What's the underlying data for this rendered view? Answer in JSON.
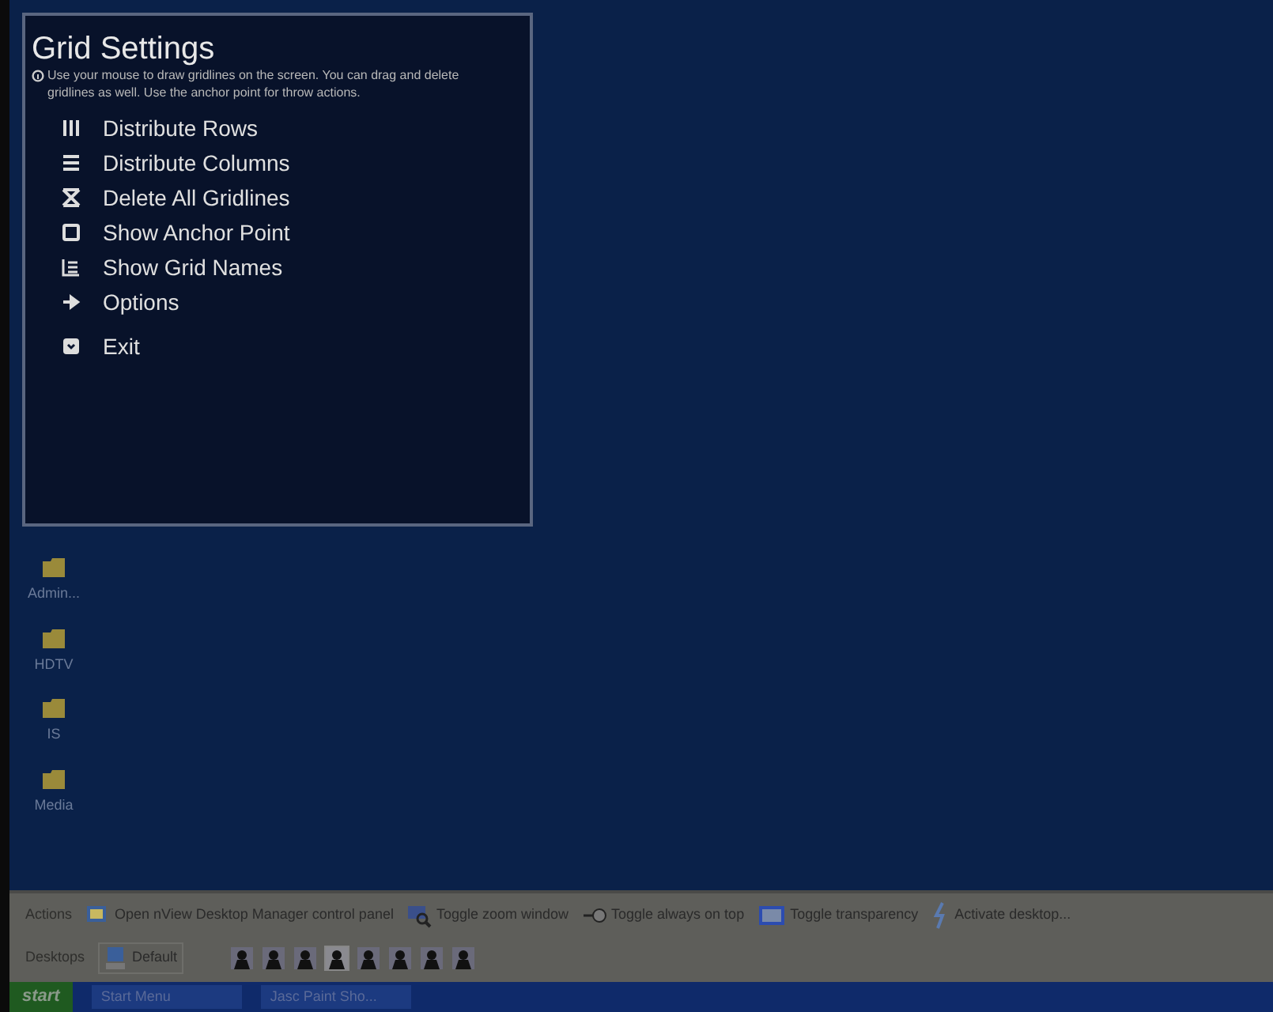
{
  "panel": {
    "title": "Grid Settings",
    "description": "Use your mouse to draw gridlines on the screen. You can drag and delete gridlines as well. Use the anchor point for throw actions.",
    "items": [
      {
        "kind": "rows",
        "label": "Distribute Rows"
      },
      {
        "kind": "columns",
        "label": "Distribute Columns"
      },
      {
        "kind": "delete",
        "label": "Delete All Gridlines"
      },
      {
        "kind": "anchor",
        "label": "Show Anchor Point"
      },
      {
        "kind": "names",
        "label": "Show Grid Names"
      },
      {
        "kind": "options",
        "label": "Options"
      },
      {
        "kind": "exit",
        "label": "Exit"
      }
    ]
  },
  "desktop_icons": [
    {
      "label": "Admin..."
    },
    {
      "label": "HDTV"
    },
    {
      "label": "IS"
    },
    {
      "label": "Media"
    }
  ],
  "toolbar": {
    "actions_label": "Actions",
    "actions": [
      {
        "kind": "panel",
        "label": "Open nView Desktop Manager control panel"
      },
      {
        "kind": "zoom",
        "label": "Toggle zoom window"
      },
      {
        "kind": "pin",
        "label": "Toggle always on top"
      },
      {
        "kind": "transparency",
        "label": "Toggle transparency"
      },
      {
        "kind": "activate",
        "label": "Activate desktop..."
      }
    ],
    "desktops_label": "Desktops",
    "default_label": "Default",
    "desktops": [
      {
        "selected": false
      },
      {
        "selected": false
      },
      {
        "selected": false
      },
      {
        "selected": true
      },
      {
        "selected": false
      },
      {
        "selected": false
      },
      {
        "selected": false
      },
      {
        "selected": false
      }
    ]
  },
  "taskbar": {
    "start": "start",
    "tasks": [
      {
        "label": "Start Menu"
      },
      {
        "label": "Jasc Paint Sho..."
      }
    ]
  }
}
